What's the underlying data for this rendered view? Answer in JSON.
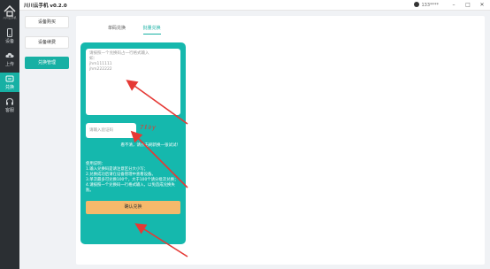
{
  "app": {
    "title": "川川云手机 v0.2.0",
    "user": "133****",
    "logo_text": "川川云手机"
  },
  "rail": {
    "items": [
      {
        "label": "设备",
        "icon": "phone-icon"
      },
      {
        "label": "上传",
        "icon": "cloud-upload-icon"
      },
      {
        "label": "兑换",
        "icon": "exchange-icon",
        "active": true
      },
      {
        "label": "客服",
        "icon": "headset-icon"
      }
    ]
  },
  "submenu": {
    "items": [
      "设备购买",
      "设备续费",
      "兑换管理"
    ],
    "active_index": 2
  },
  "tabs": [
    "单码兑换",
    "批量兑换"
  ],
  "active_tab": 1,
  "card": {
    "textarea_placeholder": "请按照一个兑换码占一行格式输入\n如：\njhm111111\njhm222222",
    "captcha_placeholder": "请输入验证码",
    "captcha_image": "7ℓ∂y",
    "refresh_text": "看不清，请点击刷新换一张试试！",
    "help_text": "使用说明：\n1.输入兑换码是请注意区分大小写；\n2.兑换成功后请在设备管理中查看设备。\n3.单次最多可兑换100个，大于100个请分批次兑换；\n4.请按照一个兑换码一行格式输入，以免造成兑换失败。",
    "confirm_label": "确认兑换"
  },
  "colors": {
    "accent": "#17b0a4",
    "card": "#15b8ad",
    "button": "#f5b96b",
    "arrow": "#e53935"
  }
}
